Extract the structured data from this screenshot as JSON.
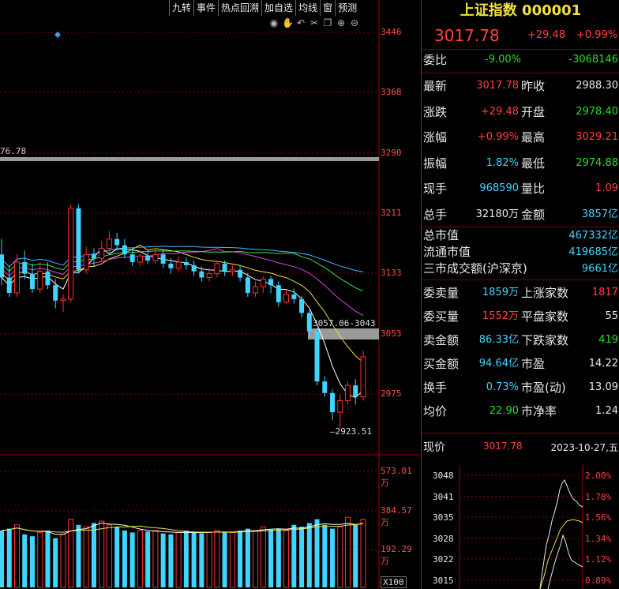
{
  "toolbar": {
    "items": [
      "九转",
      "事件",
      "热点回溯",
      "加自选",
      "均线",
      "窗",
      "预测"
    ]
  },
  "chart_icons": [
    "eye-icon",
    "hand-icon",
    "undo-icon",
    "scissors-icon",
    "copy-icon",
    "zoom-in-icon",
    "zoom-out-icon"
  ],
  "price_axis": [
    "3446",
    "3368",
    "3290",
    "3211",
    "3133",
    "3053",
    "2975"
  ],
  "volume_axis": [
    "573.01万",
    "384.57万",
    "192.29万",
    "X100"
  ],
  "chart_annotations": {
    "left_level": "76.78",
    "zone_label": "3057.06-3043",
    "low_label": "2923.51"
  },
  "chart_data": {
    "type": "candlestick",
    "ylim": [
      2900,
      3460
    ],
    "candles": [
      [
        3150,
        3120,
        3170,
        3110
      ],
      [
        3120,
        3100,
        3135,
        3095
      ],
      [
        3100,
        3140,
        3150,
        3095
      ],
      [
        3140,
        3125,
        3155,
        3118
      ],
      [
        3125,
        3105,
        3138,
        3100
      ],
      [
        3105,
        3128,
        3140,
        3100
      ],
      [
        3128,
        3110,
        3140,
        3105
      ],
      [
        3110,
        3090,
        3118,
        3080
      ],
      [
        3090,
        3092,
        3098,
        3075
      ],
      [
        3092,
        3210,
        3215,
        3088
      ],
      [
        3210,
        3130,
        3215,
        3125
      ],
      [
        3130,
        3150,
        3160,
        3125
      ],
      [
        3150,
        3145,
        3158,
        3135
      ],
      [
        3145,
        3158,
        3168,
        3140
      ],
      [
        3158,
        3170,
        3180,
        3150
      ],
      [
        3170,
        3162,
        3178,
        3155
      ],
      [
        3162,
        3150,
        3170,
        3145
      ],
      [
        3150,
        3140,
        3158,
        3135
      ],
      [
        3140,
        3148,
        3155,
        3135
      ],
      [
        3148,
        3142,
        3155,
        3138
      ],
      [
        3142,
        3150,
        3158,
        3138
      ],
      [
        3150,
        3138,
        3156,
        3132
      ],
      [
        3138,
        3132,
        3145,
        3125
      ],
      [
        3132,
        3140,
        3148,
        3128
      ],
      [
        3140,
        3136,
        3146,
        3130
      ],
      [
        3136,
        3128,
        3142,
        3122
      ],
      [
        3128,
        3120,
        3134,
        3115
      ],
      [
        3120,
        3125,
        3132,
        3115
      ],
      [
        3125,
        3138,
        3142,
        3120
      ],
      [
        3138,
        3128,
        3142,
        3122
      ],
      [
        3128,
        3130,
        3136,
        3122
      ],
      [
        3130,
        3120,
        3136,
        3115
      ],
      [
        3120,
        3100,
        3126,
        3095
      ],
      [
        3100,
        3108,
        3115,
        3095
      ],
      [
        3108,
        3118,
        3122,
        3100
      ],
      [
        3118,
        3110,
        3122,
        3100
      ],
      [
        3110,
        3088,
        3115,
        3082
      ],
      [
        3088,
        3098,
        3104,
        3085
      ],
      [
        3098,
        3092,
        3106,
        3086
      ],
      [
        3092,
        3074,
        3096,
        3068
      ],
      [
        3074,
        3050,
        3078,
        3040
      ],
      [
        3050,
        2985,
        3055,
        2980
      ],
      [
        2985,
        2970,
        2992,
        2965
      ],
      [
        2970,
        2945,
        2975,
        2935
      ],
      [
        2945,
        2960,
        2968,
        2925
      ],
      [
        2960,
        2980,
        2985,
        2955
      ],
      [
        2980,
        2965,
        2988,
        2955
      ],
      [
        2965,
        3017,
        3025,
        2960
      ]
    ],
    "ma_series": [
      {
        "color": "#ffffff",
        "values": []
      },
      {
        "color": "#f0e040",
        "values": []
      },
      {
        "color": "#e040e0",
        "values": []
      },
      {
        "color": "#40e040",
        "values": []
      },
      {
        "color": "#4fb3ff",
        "values": []
      }
    ],
    "volumes": [
      300,
      310,
      330,
      280,
      270,
      290,
      300,
      260,
      280,
      360,
      330,
      320,
      340,
      350,
      330,
      320,
      300,
      290,
      300,
      295,
      300,
      285,
      280,
      290,
      300,
      290,
      285,
      290,
      300,
      295,
      290,
      300,
      310,
      300,
      320,
      305,
      310,
      300,
      330,
      320,
      340,
      360,
      330,
      310,
      320,
      370,
      330,
      360
    ],
    "volume_ylim": [
      0,
      600
    ]
  },
  "panel": {
    "title": "上证指数 000001",
    "price": "3017.78",
    "change": "+29.48",
    "change_pct": "+0.99%",
    "weibi_label": "委比",
    "weibi_pct": "-9.00%",
    "weibi_val": "-3068146",
    "rows": [
      {
        "l1": "最新",
        "v1": "3017.78",
        "c1": "red",
        "l2": "昨收",
        "v2": "2988.30",
        "c2": "wht"
      },
      {
        "l1": "涨跌",
        "v1": "+29.48",
        "c1": "red",
        "l2": "开盘",
        "v2": "2978.40",
        "c2": "grn"
      },
      {
        "l1": "涨幅",
        "v1": "+0.99%",
        "c1": "red",
        "l2": "最高",
        "v2": "3029.21",
        "c2": "red"
      },
      {
        "l1": "振幅",
        "v1": "1.82%",
        "c1": "cyan",
        "l2": "最低",
        "v2": "2974.88",
        "c2": "grn"
      },
      {
        "l1": "现手",
        "v1": "968590",
        "c1": "cyan",
        "l2": "量比",
        "v2": "1.09",
        "c2": "red"
      },
      {
        "l1": "总手",
        "v1": "32180万",
        "c1": "wht",
        "l2": "金额",
        "v2": "3857亿",
        "c2": "cyan"
      }
    ],
    "market": [
      {
        "label": "总市值",
        "value": "467332亿"
      },
      {
        "label": "流通市值",
        "value": "419685亿"
      },
      {
        "label": "三市成交额(沪深京)",
        "value": "9661亿"
      }
    ],
    "rows2": [
      {
        "l1": "委卖量",
        "v1": "1859万",
        "c1": "cyan",
        "l2": "上涨家数",
        "v2": "1817",
        "c2": "red"
      },
      {
        "l1": "委买量",
        "v1": "1552万",
        "c1": "red",
        "l2": "平盘家数",
        "v2": "55",
        "c2": "wht"
      },
      {
        "l1": "卖金额",
        "v1": "86.33亿",
        "c1": "cyan",
        "l2": "下跌家数",
        "v2": "419",
        "c2": "grn"
      },
      {
        "l1": "买金额",
        "v1": "94.64亿",
        "c1": "cyan",
        "l2": "市盈",
        "v2": "14.22",
        "c2": "wht"
      },
      {
        "l1": "换手",
        "v1": "0.73%",
        "c1": "cyan",
        "l2": "市盈(动)",
        "v2": "13.09",
        "c2": "wht"
      },
      {
        "l1": "均价",
        "v1": "22.90",
        "c1": "grn",
        "l2": "市净率",
        "v2": "1.24",
        "c2": "wht"
      }
    ],
    "now_label": "现价",
    "now_value": "3017.78",
    "date": "2023-10-27,五",
    "mini_left": [
      "3048",
      "3041",
      "3035",
      "3028",
      "3022",
      "3015"
    ],
    "mini_right": [
      "2.00%",
      "1.78%",
      "1.56%",
      "1.34%",
      "1.12%",
      "0.89%"
    ]
  },
  "colors": {
    "up": "#ff3030",
    "down": "#3fd5ff",
    "grid": "#8a0000"
  }
}
